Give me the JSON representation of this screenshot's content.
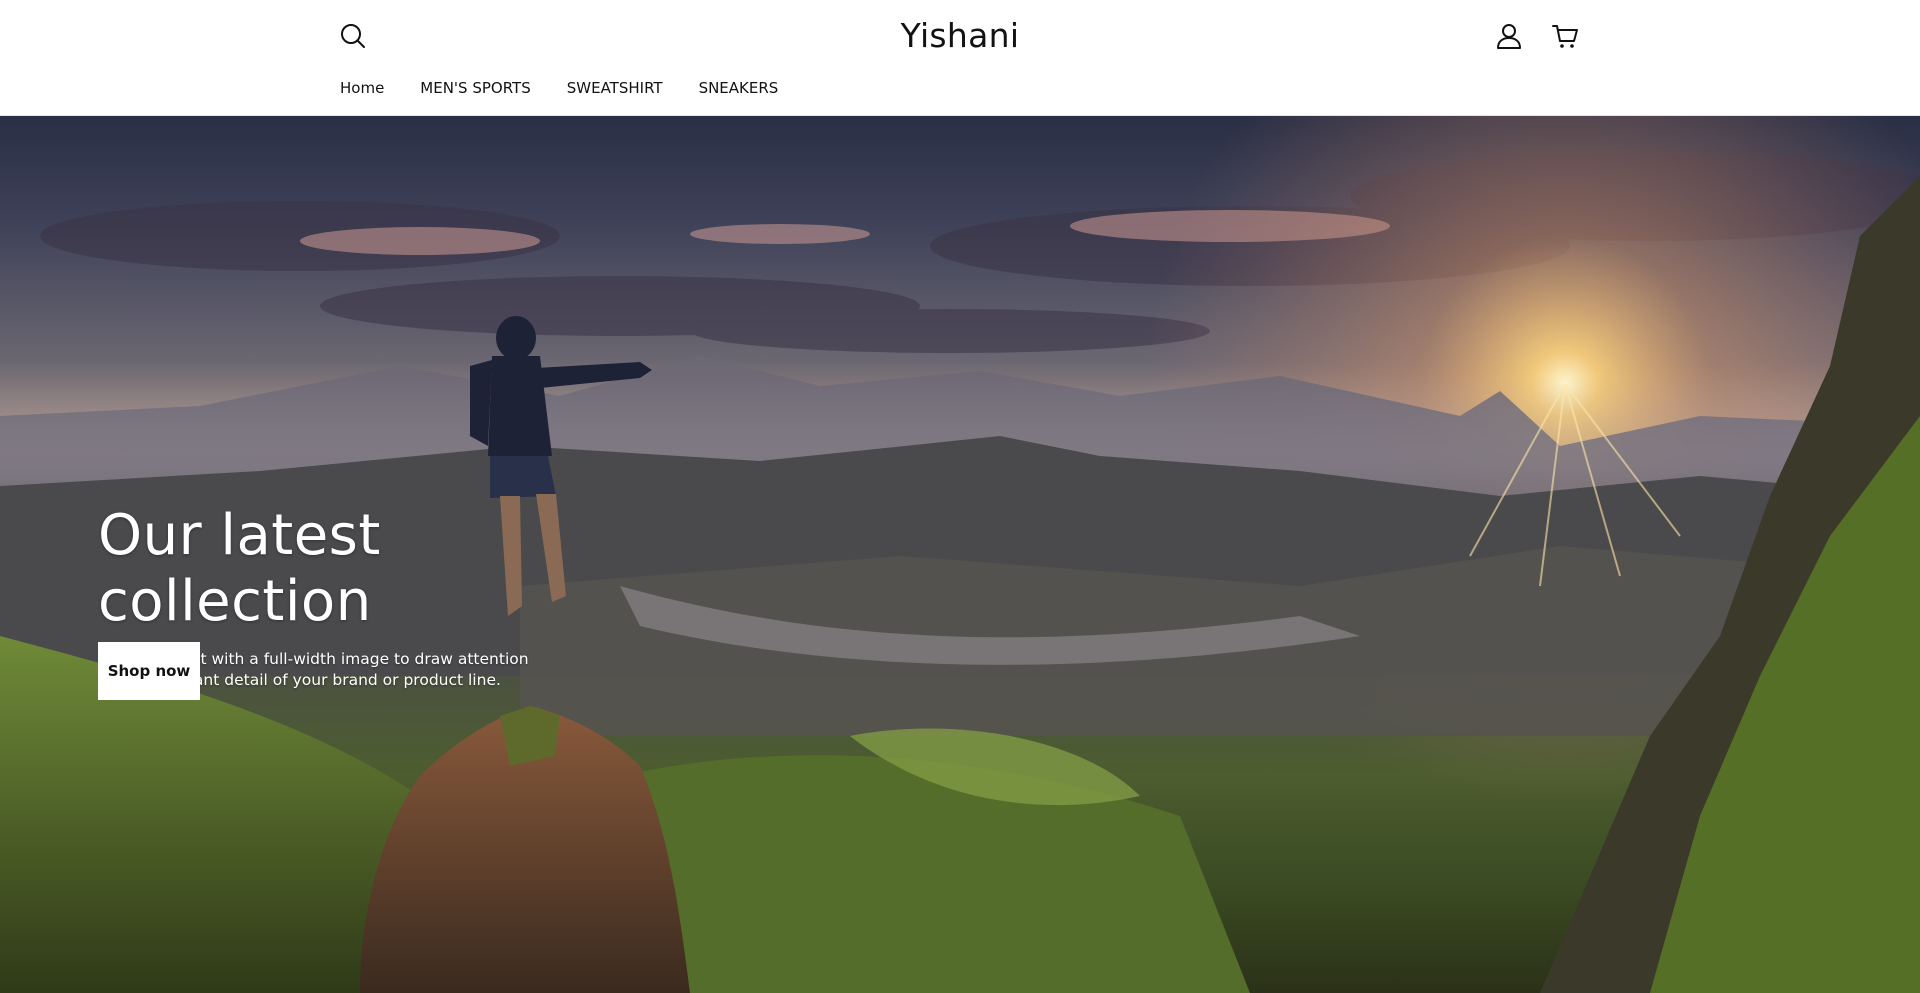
{
  "header": {
    "logo": "Yishani",
    "nav": [
      {
        "label": "Home"
      },
      {
        "label": "MEN'S SPORTS"
      },
      {
        "label": "SWEATSHIRT"
      },
      {
        "label": "SNEAKERS"
      }
    ],
    "icons": {
      "search": "search-icon",
      "account": "account-icon",
      "cart": "cart-icon"
    }
  },
  "hero": {
    "title": "Our latest collection",
    "text": "Pair large text with a full-width image to draw attention to an important detail of your brand or product line.",
    "button_label": "Shop now"
  },
  "colors": {
    "text": "#121212",
    "background": "#ffffff",
    "hero_text": "#ffffff",
    "button_bg": "#ffffff"
  }
}
